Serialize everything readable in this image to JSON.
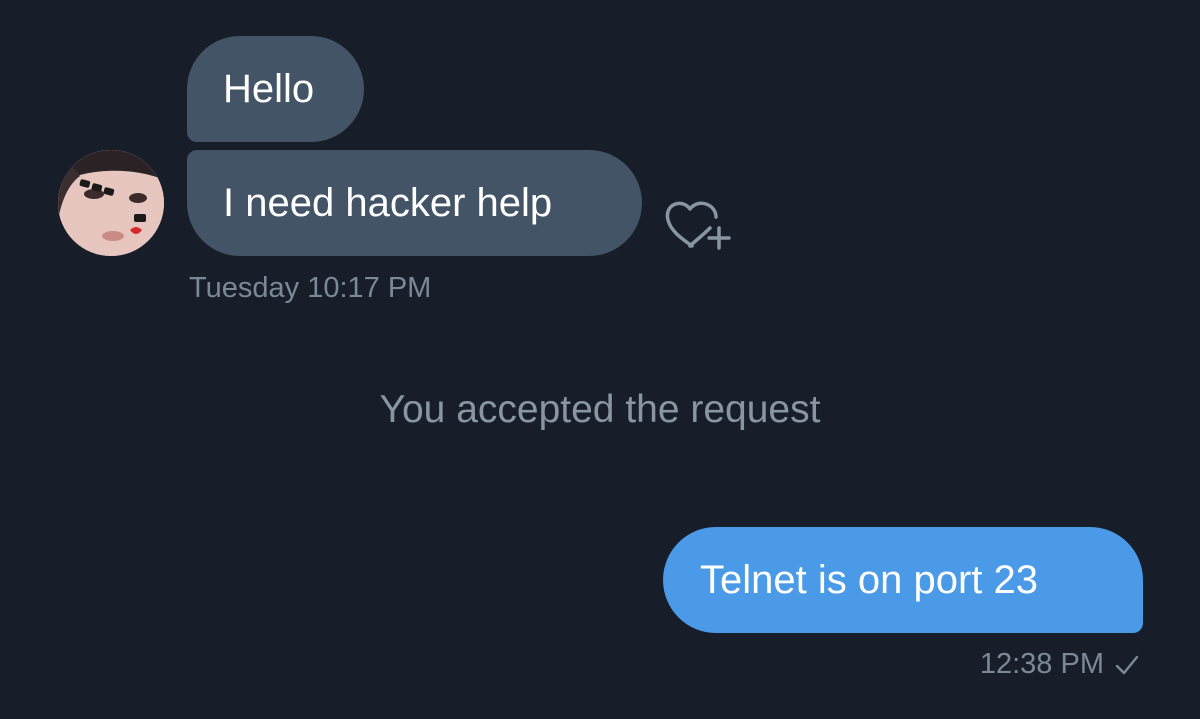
{
  "conversation": {
    "incoming": {
      "messages": [
        {
          "text": "Hello"
        },
        {
          "text": "I need hacker help"
        }
      ],
      "timestamp": "Tuesday 10:17 PM",
      "react_icon": "heart-plus-icon"
    },
    "system_message": "You accepted the request",
    "outgoing": {
      "messages": [
        {
          "text": "Telnet is on port 23"
        }
      ],
      "timestamp": "12:38 PM",
      "status_icon": "checkmark-icon"
    }
  },
  "colors": {
    "background": "#171e29",
    "incoming_bubble": "#435466",
    "outgoing_bubble": "#4a9ae8",
    "secondary_text": "#7c8895"
  }
}
